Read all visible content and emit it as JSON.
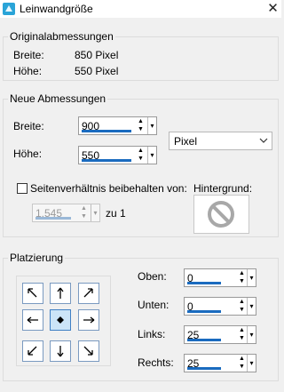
{
  "window": {
    "title": "Leinwandgröße",
    "close_glyph": "✕"
  },
  "original": {
    "label": "Originalabmessungen",
    "width_label": "Breite:",
    "width_value": "850 Pixel",
    "height_label": "Höhe:",
    "height_value": "550 Pixel"
  },
  "new_dims": {
    "label": "Neue Abmessungen",
    "width_label": "Breite:",
    "width_value": "900",
    "height_label": "Höhe:",
    "height_value": "550",
    "unit": "Pixel",
    "keep_ratio_label": "Seitenverhältnis beibehalten von:",
    "keep_ratio_checked": false,
    "ratio_value": "1,545",
    "ratio_suffix": "zu 1",
    "background_label": "Hintergrund:"
  },
  "placement": {
    "label": "Platzierung",
    "selected": "center",
    "top_label": "Oben:",
    "top_value": "0",
    "bottom_label": "Unten:",
    "bottom_value": "0",
    "left_label": "Links:",
    "left_value": "25",
    "right_label": "Rechts:",
    "right_value": "25"
  },
  "colors": {
    "accent": "#1a6bbf",
    "selected_bg": "#cce4f7"
  }
}
